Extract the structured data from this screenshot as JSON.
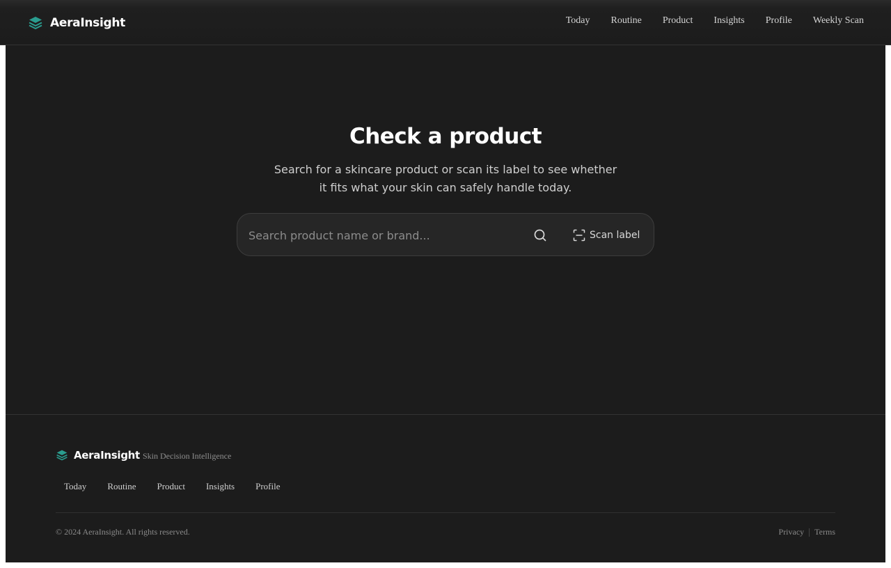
{
  "brand": {
    "name": "AeraInsight",
    "accent": "#2a9d8f"
  },
  "nav": {
    "items": [
      "Today",
      "Routine",
      "Product",
      "Insights",
      "Profile",
      "Weekly Scan"
    ]
  },
  "hero": {
    "title": "Check a product",
    "subtitle": "Search for a skincare product or scan its label to see whether it fits what your skin can safely handle today."
  },
  "search": {
    "placeholder": "Search product name or brand...",
    "value": "",
    "search_icon": "search-icon",
    "scan_icon": "scan-icon",
    "scan_label": "Scan label"
  },
  "footer": {
    "brand": "AeraInsight",
    "tagline": "Skin Decision Intelligence",
    "nav": [
      "Today",
      "Routine",
      "Product",
      "Insights",
      "Profile"
    ],
    "copyright": "© 2024 AeraInsight. All rights reserved.",
    "legal": {
      "privacy": "Privacy",
      "terms": "Terms"
    }
  }
}
